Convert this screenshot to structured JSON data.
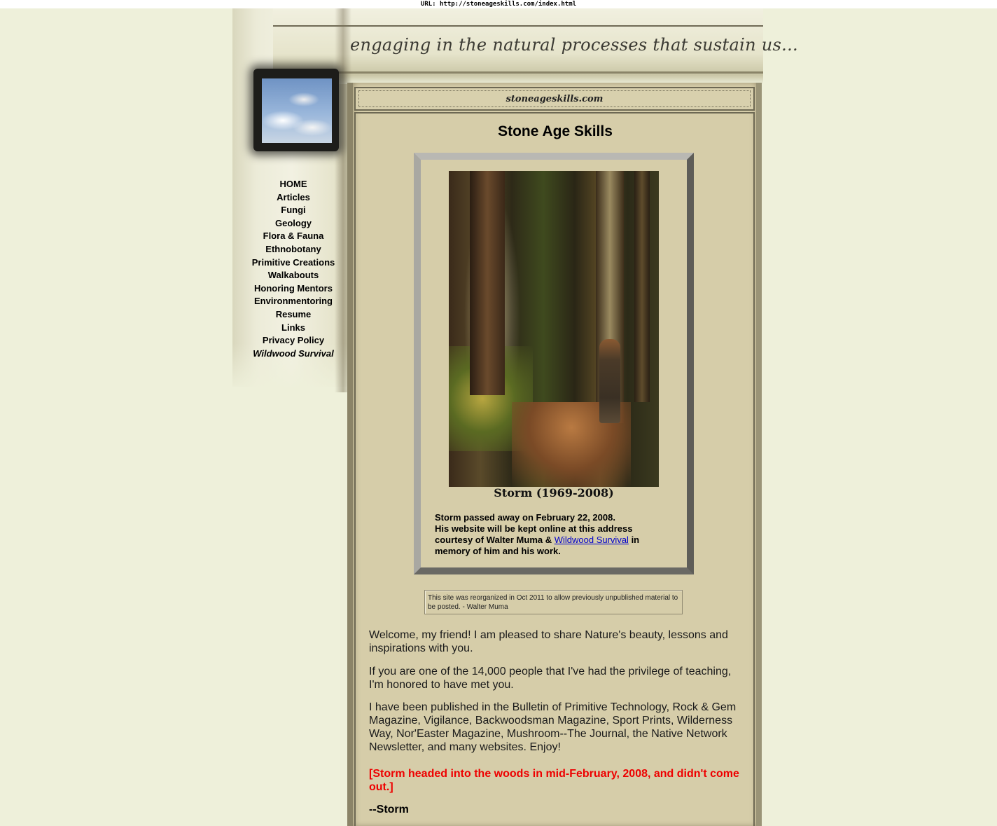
{
  "url_bar": {
    "text": "URL: http://stoneageskills.com/index.html"
  },
  "header": {
    "tagline": "engaging in the natural processes that sustain us...",
    "site_name": "stoneageskills.com"
  },
  "nav": {
    "items": [
      {
        "label": "HOME"
      },
      {
        "label": "Articles"
      },
      {
        "label": "Fungi"
      },
      {
        "label": "Geology"
      },
      {
        "label": "Flora & Fauna"
      },
      {
        "label": "Ethnobotany"
      },
      {
        "label": "Primitive Creations"
      },
      {
        "label": "Walkabouts"
      },
      {
        "label": "Honoring Mentors"
      },
      {
        "label": "Environmentoring"
      },
      {
        "label": "Resume"
      },
      {
        "label": "Links"
      },
      {
        "label": "Privacy Policy"
      },
      {
        "label": "Wildwood Survival"
      }
    ]
  },
  "main": {
    "title": "Stone Age Skills",
    "memorial": {
      "caption": "Storm (1969-2008)",
      "line1": "Storm passed away on February 22, 2008.",
      "line2": "His website will be kept online at this address courtesy of Walter Muma &",
      "link": "Wildwood Survival",
      "line3": "in memory of him and his work."
    },
    "notice": "This site was reorganized in Oct 2011 to allow previously unpublished material to be posted. - Walter Muma",
    "paragraphs": {
      "p1": "Welcome, my friend! I am pleased to share Nature's beauty, lessons and inspirations with you.",
      "p2": "If you are one of the 14,000 people that I've had the privilege of teaching, I'm honored to have met you.",
      "p3": "I have been published in the Bulletin of Primitive Technology, Rock & Gem Magazine, Vigilance, Backwoodsman Magazine, Sport Prints, Wilderness Way, Nor'Easter Magazine, Mushroom--The Journal, the Native Network Newsletter, and many websites. Enjoy!",
      "p4": "[Storm headed into the woods in mid-February, 2008, and didn't come out.]",
      "p5": "--Storm"
    }
  }
}
